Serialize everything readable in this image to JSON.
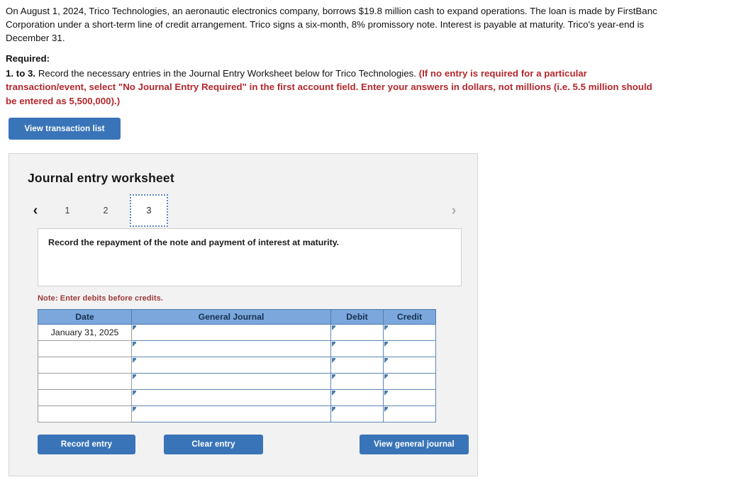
{
  "problem": {
    "text": "On August 1, 2024, Trico Technologies, an aeronautic electronics company, borrows $19.8 million cash to expand operations. The loan is made by FirstBanc Corporation under a short-term line of credit arrangement. Trico signs a six-month, 8% promissory note. Interest is payable at maturity. Trico's year-end is December 31."
  },
  "required": {
    "heading": "Required:",
    "number_prefix": "1. to 3.",
    "instruction": " Record the necessary entries in the Journal Entry Worksheet below for Trico Technologies. ",
    "emphasis": "(If no entry is required for a particular transaction/event, select \"No Journal Entry Required\" in the first account field. Enter your answers in dollars, not millions (i.e. 5.5 million should be entered as 5,500,000).)"
  },
  "toolbar": {
    "view_transaction_list_label": "View transaction list"
  },
  "worksheet": {
    "title": "Journal entry worksheet",
    "pager": {
      "prev_icon": "‹",
      "next_icon": "›",
      "pages": [
        "1",
        "2",
        "3"
      ],
      "active_page": "3"
    },
    "prompt": "Record the repayment of the note and payment of interest at maturity.",
    "note": "Note: Enter debits before credits.",
    "table": {
      "headers": [
        "Date",
        "General Journal",
        "Debit",
        "Credit"
      ],
      "rows": [
        {
          "date": "January 31, 2025",
          "general_journal": "",
          "debit": "",
          "credit": ""
        },
        {
          "date": "",
          "general_journal": "",
          "debit": "",
          "credit": ""
        },
        {
          "date": "",
          "general_journal": "",
          "debit": "",
          "credit": ""
        },
        {
          "date": "",
          "general_journal": "",
          "debit": "",
          "credit": ""
        },
        {
          "date": "",
          "general_journal": "",
          "debit": "",
          "credit": ""
        },
        {
          "date": "",
          "general_journal": "",
          "debit": "",
          "credit": ""
        }
      ]
    },
    "footer": {
      "record_entry_label": "Record entry",
      "clear_entry_label": "Clear entry",
      "view_general_journal_label": "View general journal"
    }
  },
  "colors": {
    "button_blue": "#3a74b8",
    "table_header_blue": "#7ba7dc",
    "emphasis_red": "#b3282d",
    "note_red": "#9c3b3b",
    "panel_grey": "#f2f2f2"
  }
}
